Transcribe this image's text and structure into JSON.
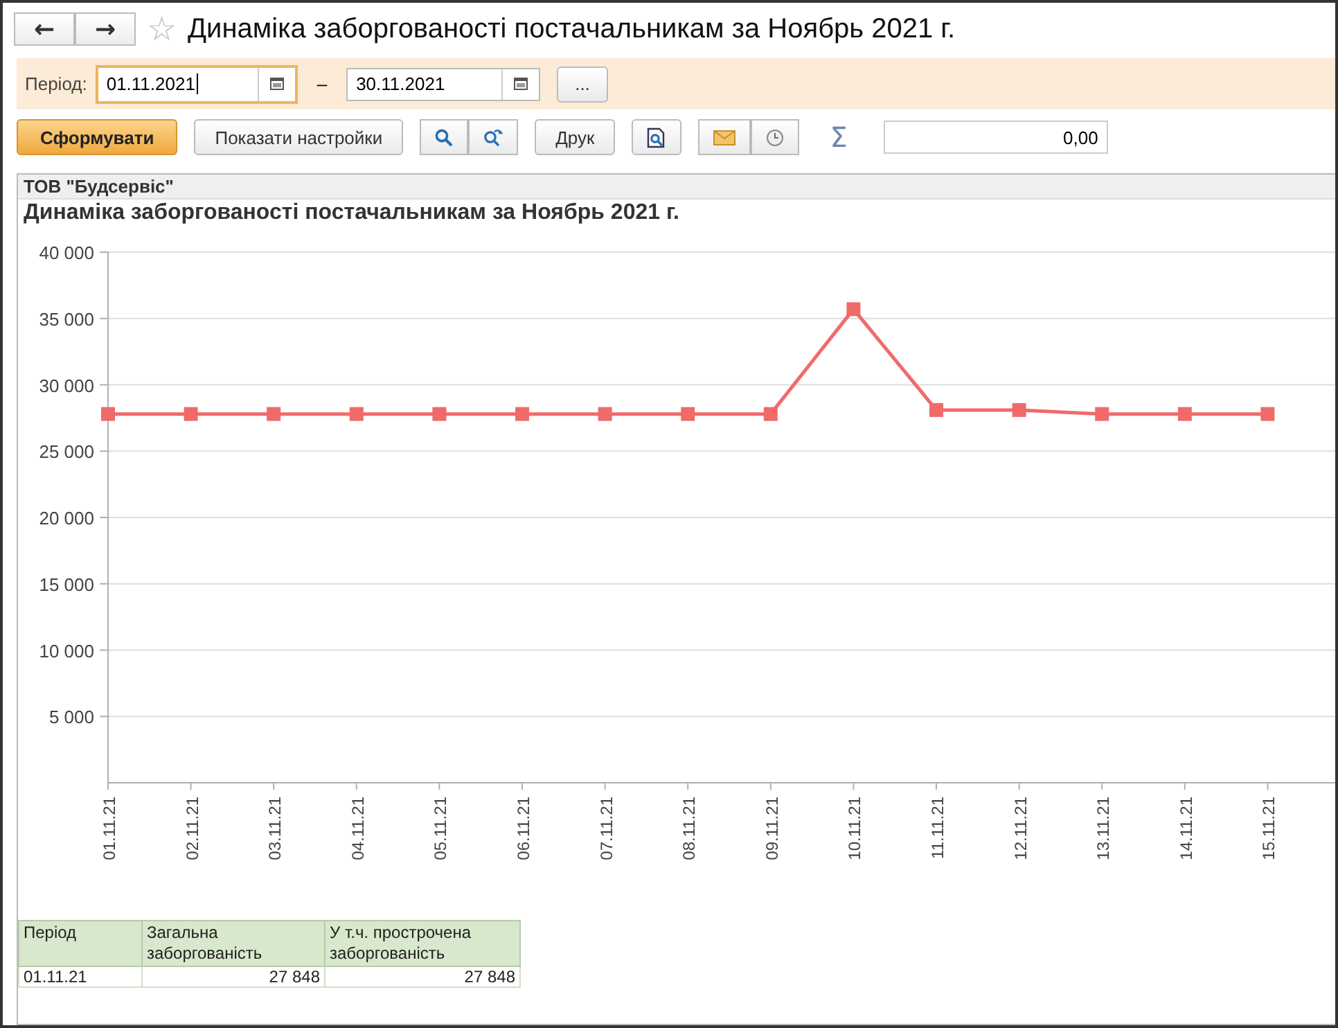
{
  "window": {
    "title": "Динаміка заборгованості постачальникам за Ноябрь 2021 г.",
    "back": "←",
    "forward": "→",
    "star": "☆"
  },
  "period": {
    "label": "Період:",
    "from": "01.11.2021",
    "dash": "–",
    "to": "30.11.2021",
    "more": "..."
  },
  "toolbar": {
    "generate": "Сформувати",
    "settings": "Показати настройки",
    "print": "Друк",
    "sigma": "Σ",
    "total": "0,00"
  },
  "report": {
    "company": "ТОВ \"Будсервіс\"",
    "title": "Динаміка заборгованості постачальникам за Ноябрь 2021 г.",
    "chart_data": {
      "type": "line",
      "categories": [
        "01.11.21",
        "02.11.21",
        "03.11.21",
        "04.11.21",
        "05.11.21",
        "06.11.21",
        "07.11.21",
        "08.11.21",
        "09.11.21",
        "10.11.21",
        "11.11.21",
        "12.11.21",
        "13.11.21",
        "14.11.21",
        "15.11.21"
      ],
      "series": [
        {
          "color": "#f06a6a",
          "marker": "square",
          "values": [
            27800,
            27800,
            27800,
            27800,
            27800,
            27800,
            27800,
            27800,
            27800,
            35700,
            28100,
            28100,
            27800,
            27800,
            27800
          ]
        }
      ],
      "grid": true,
      "ylim": [
        0,
        40000
      ],
      "yticks": [
        {
          "value": 5000,
          "label": "5 000"
        },
        {
          "value": 10000,
          "label": "10 000"
        },
        {
          "value": 15000,
          "label": "15 000"
        },
        {
          "value": 20000,
          "label": "20 000"
        },
        {
          "value": 25000,
          "label": "25 000"
        },
        {
          "value": 30000,
          "label": "30 000"
        },
        {
          "value": 35000,
          "label": "35 000"
        },
        {
          "value": 40000,
          "label": "40 000"
        }
      ]
    },
    "table": {
      "columns": [
        "Період",
        "Загальна заборгованість",
        "У т.ч. прострочена заборгованість"
      ],
      "rows": [
        [
          "01.11.21",
          "27 848",
          "27 848"
        ]
      ]
    }
  }
}
